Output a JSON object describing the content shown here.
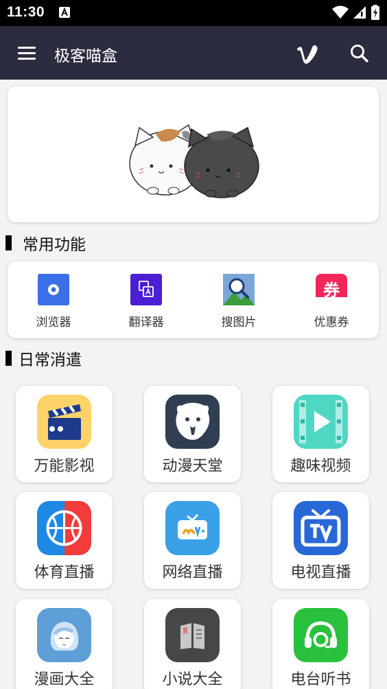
{
  "status_bar": {
    "time": "11:30"
  },
  "app_bar": {
    "title": "极客喵盒"
  },
  "sections": {
    "common": "常用功能",
    "daily": "日常消遣"
  },
  "tools": [
    {
      "label": "浏览器",
      "icon": "browser-icon"
    },
    {
      "label": "翻译器",
      "icon": "translate-icon"
    },
    {
      "label": "搜图片",
      "icon": "image-search-icon"
    },
    {
      "label": "优惠券",
      "icon": "coupon-icon"
    }
  ],
  "apps": [
    {
      "label": "万能影视",
      "icon": "clapperboard-icon"
    },
    {
      "label": "动漫天堂",
      "icon": "anime-bear-icon"
    },
    {
      "label": "趣味视频",
      "icon": "video-play-icon"
    },
    {
      "label": "体育直播",
      "icon": "basketball-icon"
    },
    {
      "label": "网络直播",
      "icon": "live-tv-icon"
    },
    {
      "label": "电视直播",
      "icon": "tv-icon"
    },
    {
      "label": "漫画大全",
      "icon": "manga-girl-icon"
    },
    {
      "label": "小说大全",
      "icon": "book-icon"
    },
    {
      "label": "电台听书",
      "icon": "headphones-icon"
    }
  ],
  "tool_glyphs": {
    "coupon": "券"
  },
  "colors": {
    "app_bar": "#2c2c40",
    "browser": "#3a6fe8",
    "translate": "#4a1fd6",
    "coupon": "#f0285a"
  }
}
